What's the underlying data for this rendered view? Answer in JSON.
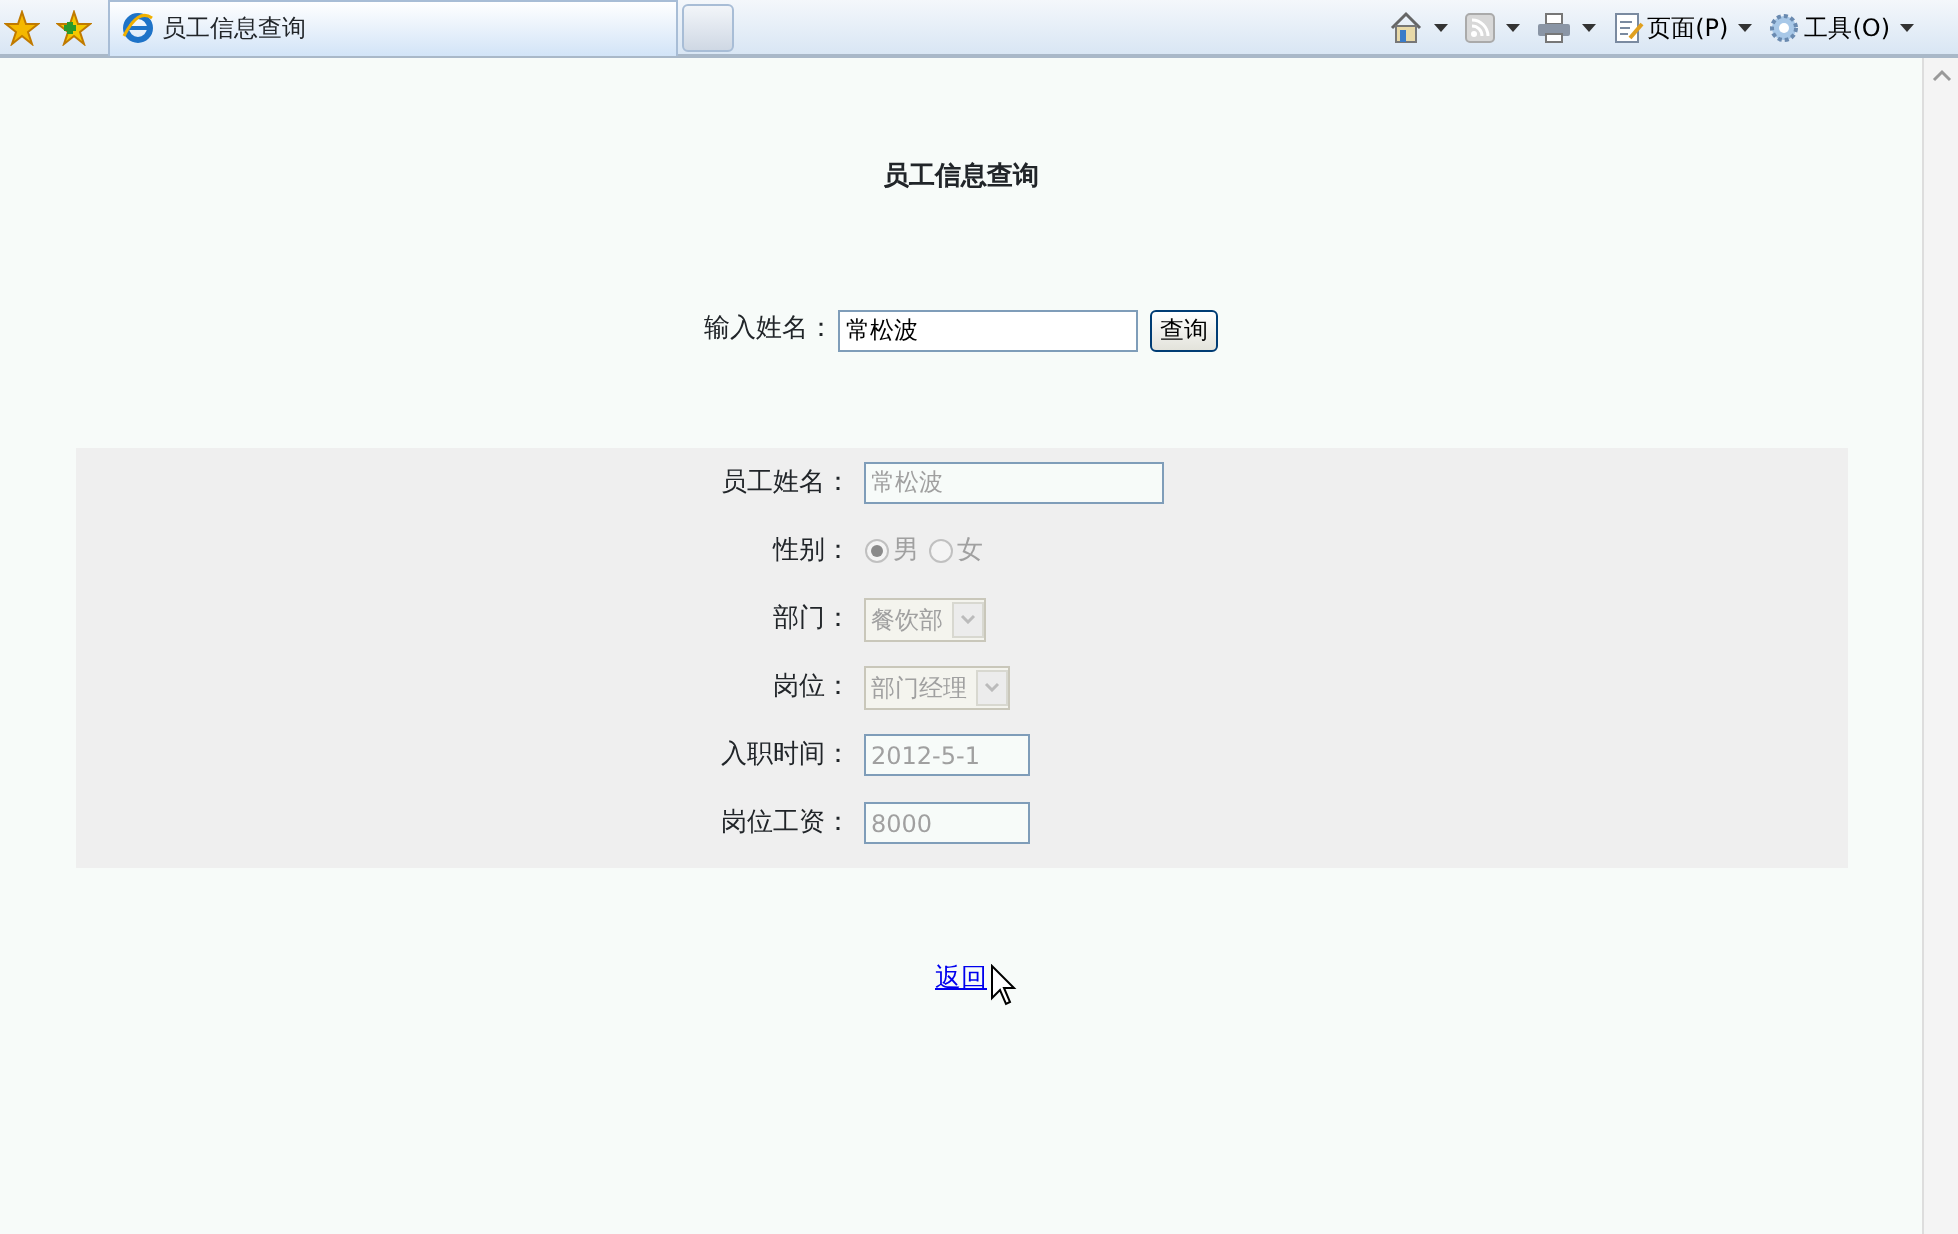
{
  "browser": {
    "tab_title": "员工信息查询",
    "commands": [
      {
        "kind": "home"
      },
      {
        "kind": "feed"
      },
      {
        "kind": "print"
      },
      {
        "kind": "page",
        "label": "页面(P)"
      },
      {
        "kind": "tools",
        "label": "工具(O)"
      }
    ]
  },
  "page": {
    "title": "员工信息查询",
    "search": {
      "label": "输入姓名：",
      "value": "常松波",
      "button": "查询"
    },
    "fields": [
      {
        "kind": "text",
        "label": "员工姓名：",
        "value": "常松波",
        "disabled": true
      },
      {
        "kind": "radio",
        "label": "性别：",
        "disabled": true,
        "options": [
          {
            "label": "男",
            "selected": true
          },
          {
            "label": "女",
            "selected": false
          }
        ]
      },
      {
        "kind": "select",
        "label": "部门：",
        "value": "餐饮部",
        "disabled": true
      },
      {
        "kind": "select",
        "label": "岗位：",
        "value": "部门经理",
        "disabled": true
      },
      {
        "kind": "short",
        "label": "入职时间：",
        "value": "2012-5-1",
        "disabled": true
      },
      {
        "kind": "short",
        "label": "岗位工资：",
        "value": "8000",
        "disabled": true
      }
    ],
    "back_link": "返回"
  }
}
